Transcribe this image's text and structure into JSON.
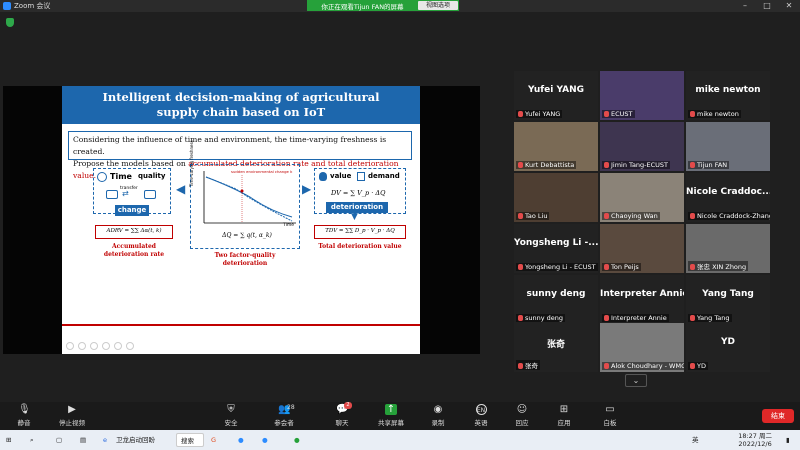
{
  "window": {
    "title": "Zoom 会议",
    "share_banner": "你正在观看Tijun FAN的屏幕",
    "view_options": "视图选项"
  },
  "slide": {
    "title_line1": "Intelligent decision-making of agricultural",
    "title_line2": "supply chain based on IoT",
    "intro_line1": "Considering the influence of time and environment, the time-varying freshness is created.",
    "intro_line2_prefix": "Propose the models based on ",
    "intro_line2_red": "accumulated deterioration rate and total deterioration value.",
    "left_panel": {
      "time_label": "Time",
      "quality_label": "quality",
      "transfer_label": "transfer",
      "change_label": "change",
      "formula": "ADRV = ∑∑ Δα(t, k)",
      "caption_line1": "Accumulated",
      "caption_line2": "deterioration rate"
    },
    "middle_panel": {
      "ylabel": "Time-varying freshness",
      "xlabel": "Time",
      "annotation": "sudden environmental change k",
      "formula": "ΔQ = ∑ q(t, α_k)",
      "caption_line1": "Two factor-quality",
      "caption_line2": "deterioration"
    },
    "right_panel": {
      "value_label": "value",
      "demand_label": "demand",
      "dv_formula": "DV = ∑ V_p · ΔQ",
      "deterioration_label": "deterioration",
      "formula": "TDV = ∑∑ D_p · V_p · ΔQ",
      "caption": "Total deterioration value"
    }
  },
  "gallery": [
    {
      "big_name": "Yufei YANG",
      "label": "Yufei YANG",
      "type": "name"
    },
    {
      "big_name": "",
      "label": "ECUST",
      "type": "video",
      "bg": "#4a3c6a"
    },
    {
      "big_name": "mike newton",
      "label": "mike newton",
      "type": "name"
    },
    {
      "big_name": "",
      "label": "Kurt Debattista",
      "type": "video",
      "bg": "#7a6a55"
    },
    {
      "big_name": "",
      "label": "Jimin Tang-ECUST",
      "type": "video",
      "bg": "#3e3550"
    },
    {
      "big_name": "",
      "label": "Tijun FAN",
      "type": "video",
      "bg": "#6a6e78",
      "speaking": true
    },
    {
      "big_name": "",
      "label": "Tao Liu",
      "type": "video",
      "bg": "#4e3e32"
    },
    {
      "big_name": "",
      "label": "Chaoying Wan",
      "type": "video",
      "bg": "#8b8378"
    },
    {
      "big_name": "Nicole Craddoc...",
      "label": "Nicole Craddock-Zhang",
      "type": "name"
    },
    {
      "big_name": "Yongsheng Li -...",
      "label": "Yongsheng Li - ECUST",
      "type": "name"
    },
    {
      "big_name": "",
      "label": "Ton Peijs",
      "type": "video",
      "bg": "#5a4a3e"
    },
    {
      "big_name": "",
      "label": "张忠 XIN Zhong",
      "type": "video",
      "bg": "#6a6a6a"
    },
    {
      "big_name": "sunny deng",
      "label": "sunny deng",
      "type": "name"
    },
    {
      "big_name": "Interpreter Annie",
      "label": "Interpreter Annie",
      "type": "name"
    },
    {
      "big_name": "Yang Tang",
      "label": "Yang Tang",
      "type": "name"
    },
    {
      "big_name": "张奇",
      "label": "张奇",
      "type": "name"
    },
    {
      "big_name": "",
      "label": "Alok Choudhary - WMG",
      "type": "video",
      "bg": "#7a7a7a"
    },
    {
      "big_name": "YD",
      "label": "YD",
      "type": "name"
    }
  ],
  "toolbar": {
    "mute": "静音",
    "stop_video": "停止视频",
    "security": "安全",
    "participants": "参会者",
    "participants_count": "28",
    "chat": "聊天",
    "chat_badge": "2",
    "share_screen": "共享屏幕",
    "record": "录制",
    "language": "英语",
    "language_icon": "EN",
    "reactions": "回应",
    "apps": "应用",
    "whiteboard": "白板",
    "end": "结束"
  },
  "taskbar": {
    "app1": "卫龙启动回盼",
    "search": "搜索一下",
    "ime": "英",
    "time": "18:27 周二",
    "date": "2022/12/6"
  },
  "colors": {
    "slide_header": "#1d67ad",
    "accent_red": "#c00000",
    "share_green": "#26a13a",
    "end_red": "#e02828"
  }
}
